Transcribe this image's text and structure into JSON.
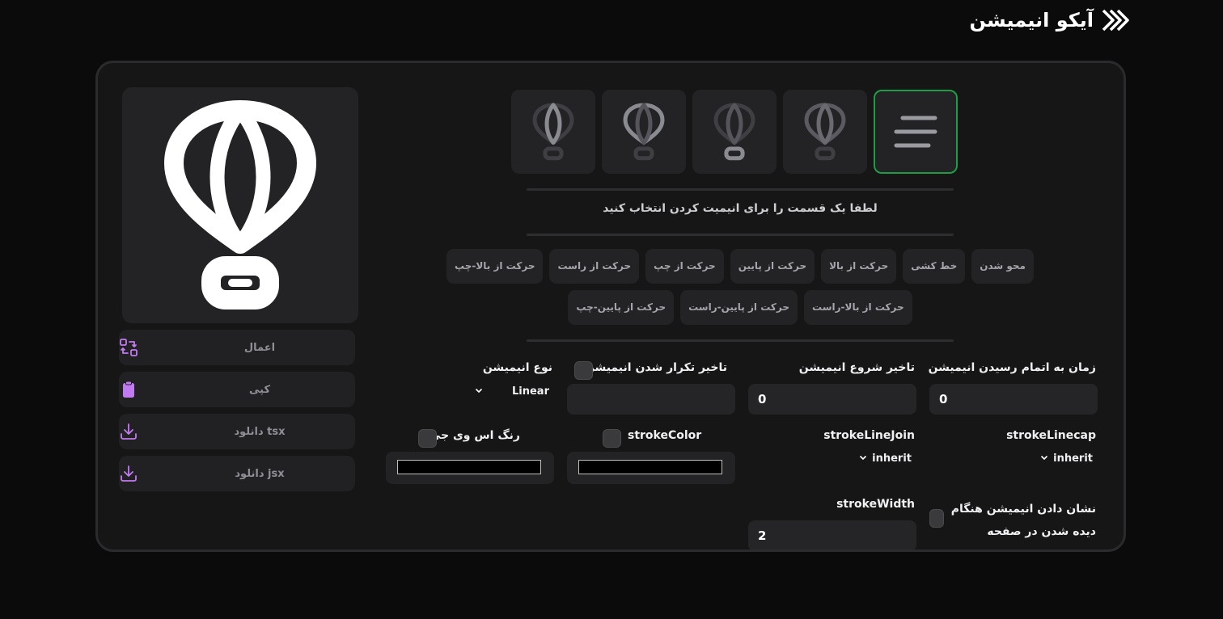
{
  "app": {
    "title": "آیکو انیمیشن"
  },
  "actions": [
    {
      "label": "اعمال",
      "icon": "arrows-swap-icon"
    },
    {
      "label": "کپی",
      "icon": "clipboard-icon"
    },
    {
      "label": "دانلود tsx",
      "icon": "download-icon"
    },
    {
      "label": "دانلود jsx",
      "icon": "download-icon"
    }
  ],
  "instruction": "لطفا یک قسمت را برای انیمیت کردن انتخاب کنید",
  "animations": [
    "محو شدن",
    "خط کشی",
    "حرکت از بالا",
    "حرکت از پایین",
    "حرکت از چپ",
    "حرکت از راست",
    "حرکت از بالا-چپ",
    "حرکت از بالا-راست",
    "حرکت از پایین-راست",
    "حرکت از پایین-چپ"
  ],
  "fields": {
    "duration": {
      "label": "زمان به اتمام رسیدن انیمیشن",
      "value": "0"
    },
    "delay": {
      "label": "تاخیر شروع انیمیشن",
      "value": "0"
    },
    "repeat_delay": {
      "label": "تاخیر تکرار شدن انیمیشن"
    },
    "animation_type": {
      "label": "نوع انیمیشن",
      "value": "Linear"
    },
    "stroke_linecap": {
      "label": "strokeLinecap",
      "value": "inherit"
    },
    "stroke_linejoin": {
      "label": "strokeLineJoin",
      "value": "inherit"
    },
    "stroke_color": {
      "label": "strokeColor",
      "value": "#000000"
    },
    "svg_color": {
      "label": "رنگ اس وی جی",
      "value": "#000000"
    },
    "on_view": {
      "label_line1": "نشان دادن انیمیشن هنگام",
      "label_line2": "دیده شدن در صفحه"
    },
    "stroke_width": {
      "label": "strokeWidth",
      "value": "2"
    }
  },
  "colors": {
    "accent_green": "#1f9c46",
    "icon_purple": "#c27af0",
    "background": "#0b0b0c"
  }
}
